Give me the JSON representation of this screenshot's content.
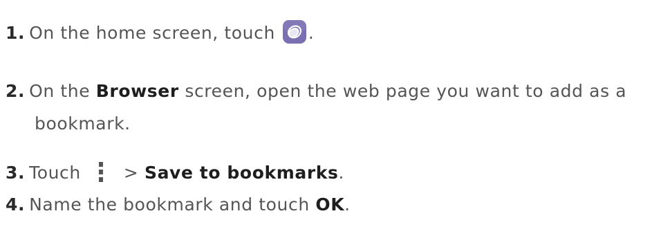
{
  "steps": [
    {
      "number": "1.",
      "text_before": "On the home screen, touch",
      "icon": "browser-icon",
      "text_after": "."
    },
    {
      "number": "2.",
      "text_before": "On the",
      "bold": "Browser",
      "text_after": "screen, open the web page you want to add as a",
      "continuation": "bookmark."
    },
    {
      "number": "3.",
      "text_before": "Touch",
      "icon": "more-menu-icon",
      "separator": ">",
      "bold": "Save to bookmarks",
      "text_after": "."
    },
    {
      "number": "4.",
      "text_before": "Name the bookmark and touch",
      "bold": "OK",
      "text_after": "."
    }
  ],
  "colors": {
    "text": "#555555",
    "bold_text": "#1e1e1e",
    "browser_icon_bg": "#7a6fb0",
    "menu_icon": "#555555"
  }
}
